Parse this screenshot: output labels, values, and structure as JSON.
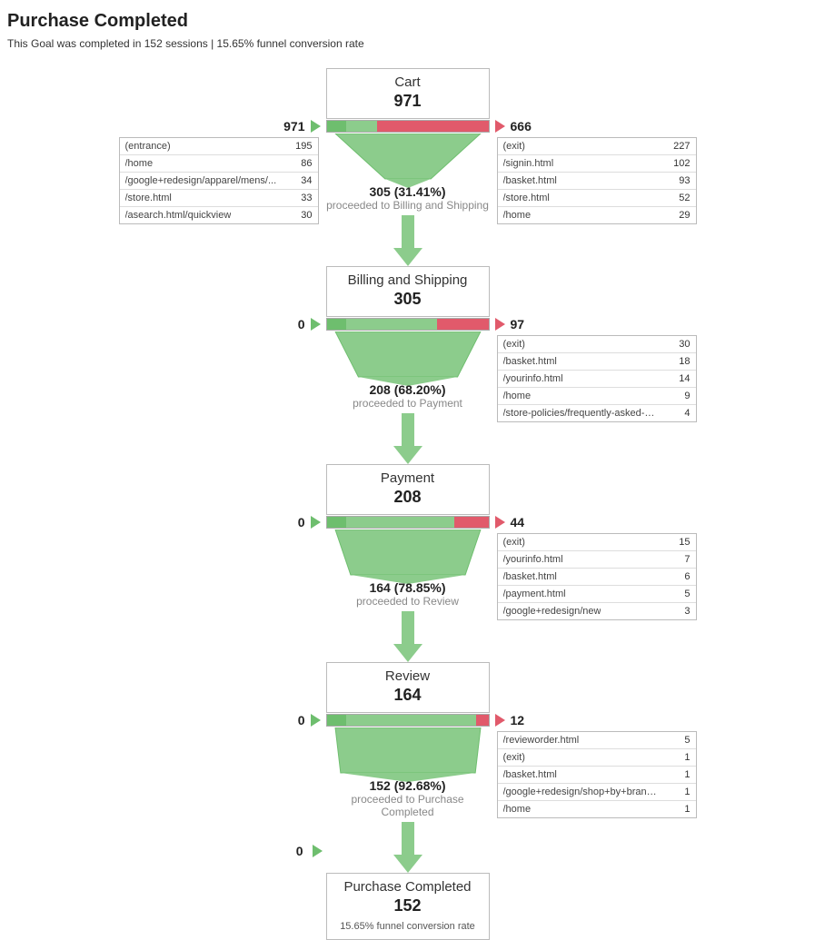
{
  "header": {
    "title": "Purchase Completed",
    "subhead": "This Goal was completed in 152 sessions | 15.65% funnel conversion rate"
  },
  "steps": [
    {
      "title": "Cart",
      "count": "971",
      "in_count": "971",
      "out_count": "666",
      "proceed_count": "305",
      "proceed_pct": "(31.41%)",
      "proceed_label": "proceeded to Billing and Shipping",
      "bar_pct_proceed": 31.41,
      "in_rows": [
        {
          "path": "(entrance)",
          "val": "195"
        },
        {
          "path": "/home",
          "val": "86"
        },
        {
          "path": "/google+redesign/apparel/mens/...",
          "val": "34"
        },
        {
          "path": "/store.html",
          "val": "33"
        },
        {
          "path": "/asearch.html/quickview",
          "val": "30"
        }
      ],
      "out_rows": [
        {
          "path": "(exit)",
          "val": "227"
        },
        {
          "path": "/signin.html",
          "val": "102"
        },
        {
          "path": "/basket.html",
          "val": "93"
        },
        {
          "path": "/store.html",
          "val": "52"
        },
        {
          "path": "/home",
          "val": "29"
        }
      ]
    },
    {
      "title": "Billing and Shipping",
      "count": "305",
      "in_count": "0",
      "out_count": "97",
      "proceed_count": "208",
      "proceed_pct": "(68.20%)",
      "proceed_label": "proceeded to Payment",
      "bar_pct_proceed": 68.2,
      "in_rows": [],
      "out_rows": [
        {
          "path": "(exit)",
          "val": "30"
        },
        {
          "path": "/basket.html",
          "val": "18"
        },
        {
          "path": "/yourinfo.html",
          "val": "14"
        },
        {
          "path": "/home",
          "val": "9"
        },
        {
          "path": "/store-policies/frequently-asked-q...",
          "val": "4"
        }
      ]
    },
    {
      "title": "Payment",
      "count": "208",
      "in_count": "0",
      "out_count": "44",
      "proceed_count": "164",
      "proceed_pct": "(78.85%)",
      "proceed_label": "proceeded to Review",
      "bar_pct_proceed": 78.85,
      "in_rows": [],
      "out_rows": [
        {
          "path": "(exit)",
          "val": "15"
        },
        {
          "path": "/yourinfo.html",
          "val": "7"
        },
        {
          "path": "/basket.html",
          "val": "6"
        },
        {
          "path": "/payment.html",
          "val": "5"
        },
        {
          "path": "/google+redesign/new",
          "val": "3"
        }
      ]
    },
    {
      "title": "Review",
      "count": "164",
      "in_count": "0",
      "out_count": "12",
      "proceed_count": "152",
      "proceed_pct": "(92.68%)",
      "proceed_label": "proceeded to Purchase Completed",
      "bar_pct_proceed": 92.68,
      "in_rows": [],
      "out_rows": [
        {
          "path": "/revieworder.html",
          "val": "5"
        },
        {
          "path": "(exit)",
          "val": "1"
        },
        {
          "path": "/basket.html",
          "val": "1"
        },
        {
          "path": "/google+redesign/shop+by+brand...",
          "val": "1"
        },
        {
          "path": "/home",
          "val": "1"
        }
      ]
    }
  ],
  "final": {
    "title": "Purchase Completed",
    "count": "152",
    "in_count": "0",
    "rate": "15.65% funnel conversion rate"
  },
  "chart_data": {
    "type": "funnel",
    "title": "Purchase Completed",
    "conversion_rate_pct": 15.65,
    "completed_sessions": 152,
    "steps": [
      {
        "name": "Cart",
        "sessions": 971,
        "entries": 971,
        "exits": 666,
        "proceeded": 305,
        "proceed_pct": 31.41
      },
      {
        "name": "Billing and Shipping",
        "sessions": 305,
        "entries": 0,
        "exits": 97,
        "proceeded": 208,
        "proceed_pct": 68.2
      },
      {
        "name": "Payment",
        "sessions": 208,
        "entries": 0,
        "exits": 44,
        "proceeded": 164,
        "proceed_pct": 78.85
      },
      {
        "name": "Review",
        "sessions": 164,
        "entries": 0,
        "exits": 12,
        "proceeded": 152,
        "proceed_pct": 92.68
      },
      {
        "name": "Purchase Completed",
        "sessions": 152
      }
    ],
    "step_entry_sources": {
      "Cart": [
        {
          "path": "(entrance)",
          "count": 195
        },
        {
          "path": "/home",
          "count": 86
        },
        {
          "path": "/google+redesign/apparel/mens/...",
          "count": 34
        },
        {
          "path": "/store.html",
          "count": 33
        },
        {
          "path": "/asearch.html/quickview",
          "count": 30
        }
      ]
    },
    "step_exit_destinations": {
      "Cart": [
        {
          "path": "(exit)",
          "count": 227
        },
        {
          "path": "/signin.html",
          "count": 102
        },
        {
          "path": "/basket.html",
          "count": 93
        },
        {
          "path": "/store.html",
          "count": 52
        },
        {
          "path": "/home",
          "count": 29
        }
      ],
      "Billing and Shipping": [
        {
          "path": "(exit)",
          "count": 30
        },
        {
          "path": "/basket.html",
          "count": 18
        },
        {
          "path": "/yourinfo.html",
          "count": 14
        },
        {
          "path": "/home",
          "count": 9
        },
        {
          "path": "/store-policies/frequently-asked-q...",
          "count": 4
        }
      ],
      "Payment": [
        {
          "path": "(exit)",
          "count": 15
        },
        {
          "path": "/yourinfo.html",
          "count": 7
        },
        {
          "path": "/basket.html",
          "count": 6
        },
        {
          "path": "/payment.html",
          "count": 5
        },
        {
          "path": "/google+redesign/new",
          "count": 3
        }
      ],
      "Review": [
        {
          "path": "/revieworder.html",
          "count": 5
        },
        {
          "path": "(exit)",
          "count": 1
        },
        {
          "path": "/basket.html",
          "count": 1
        },
        {
          "path": "/google+redesign/shop+by+brand...",
          "count": 1
        },
        {
          "path": "/home",
          "count": 1
        }
      ]
    }
  }
}
